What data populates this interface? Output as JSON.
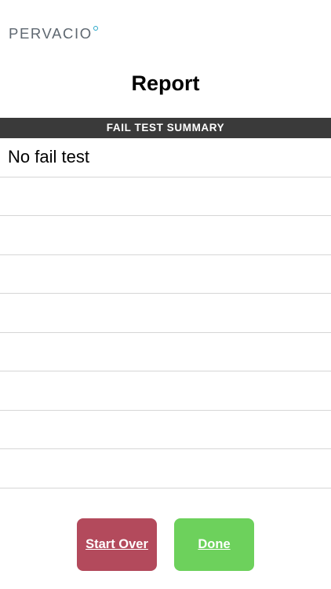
{
  "brand": {
    "logo_text": "PERVACIO",
    "accent_color": "#2aa8c9"
  },
  "header": {
    "title": "Report"
  },
  "section": {
    "title": "FAIL TEST SUMMARY",
    "bar_color": "#3a3a3a"
  },
  "fail_tests": {
    "rows": [
      "No fail test",
      "",
      "",
      "",
      "",
      "",
      "",
      "",
      ""
    ]
  },
  "actions": {
    "start_over_label": "Start Over",
    "start_over_color": "#b34a5c",
    "done_label": "Done",
    "done_color": "#6dd15c"
  }
}
